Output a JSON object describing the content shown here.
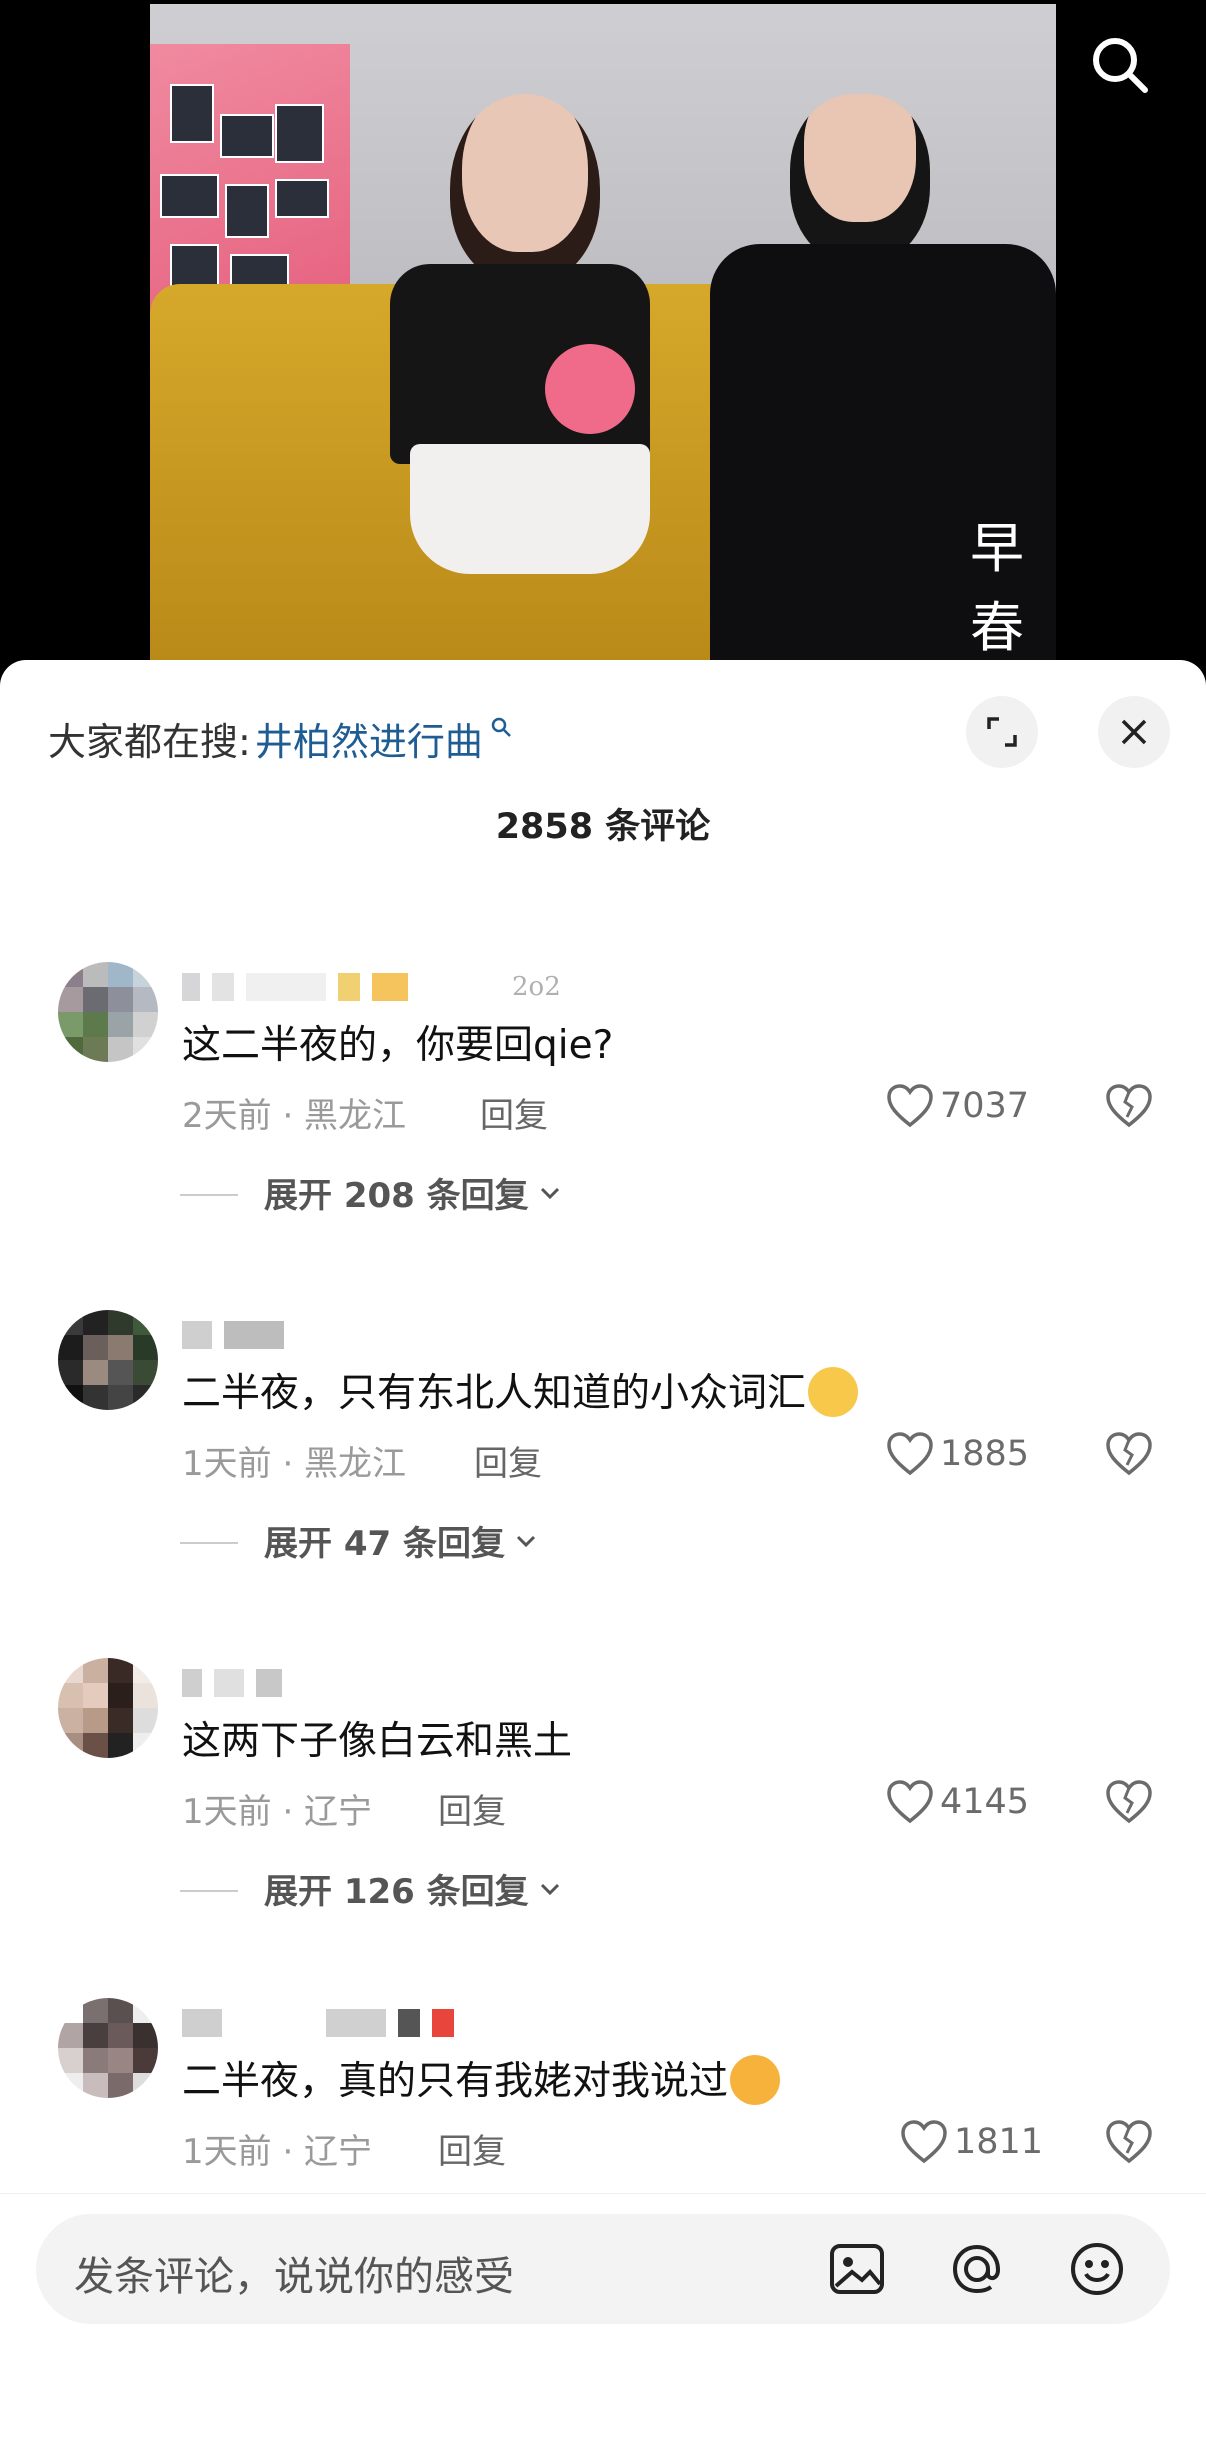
{
  "video": {
    "logo_text": "早春",
    "search_icon": "search-icon"
  },
  "trending": {
    "prefix": "大家都在搜:",
    "keyword": "井柏然进行曲",
    "icons": [
      "expand-icon",
      "close-icon"
    ]
  },
  "comments_header": {
    "count_label": "2858 条评论"
  },
  "comments": [
    {
      "username_fragment": "2o2",
      "text": "这二半夜的，你要回qie?",
      "meta": "2天前 · 黑龙江",
      "reply_label": "回复",
      "likes": "7037",
      "expand_label": "展开 208 条回复"
    },
    {
      "text": "二半夜，只有东北人知道的小众词汇",
      "emoji": "shy-glasses-emoji",
      "meta": "1天前 · 黑龙江",
      "reply_label": "回复",
      "likes": "1885",
      "expand_label": "展开 47 条回复"
    },
    {
      "text": "这两下子像白云和黑土",
      "meta": "1天前 · 辽宁",
      "reply_label": "回复",
      "likes": "4145",
      "expand_label": "展开 126 条回复"
    },
    {
      "text": "二半夜，真的只有我姥对我说过",
      "emoji": "laughing-crying-emoji",
      "meta": "1天前 · 辽宁",
      "reply_label": "回复",
      "likes": "1811"
    }
  ],
  "input": {
    "placeholder": "发条评论，说说你的感受",
    "icons": [
      "image-icon",
      "at-icon",
      "emoji-icon"
    ]
  },
  "colors": {
    "keyword_blue": "#1f5c93",
    "meta_gray": "#9a9a9a"
  }
}
